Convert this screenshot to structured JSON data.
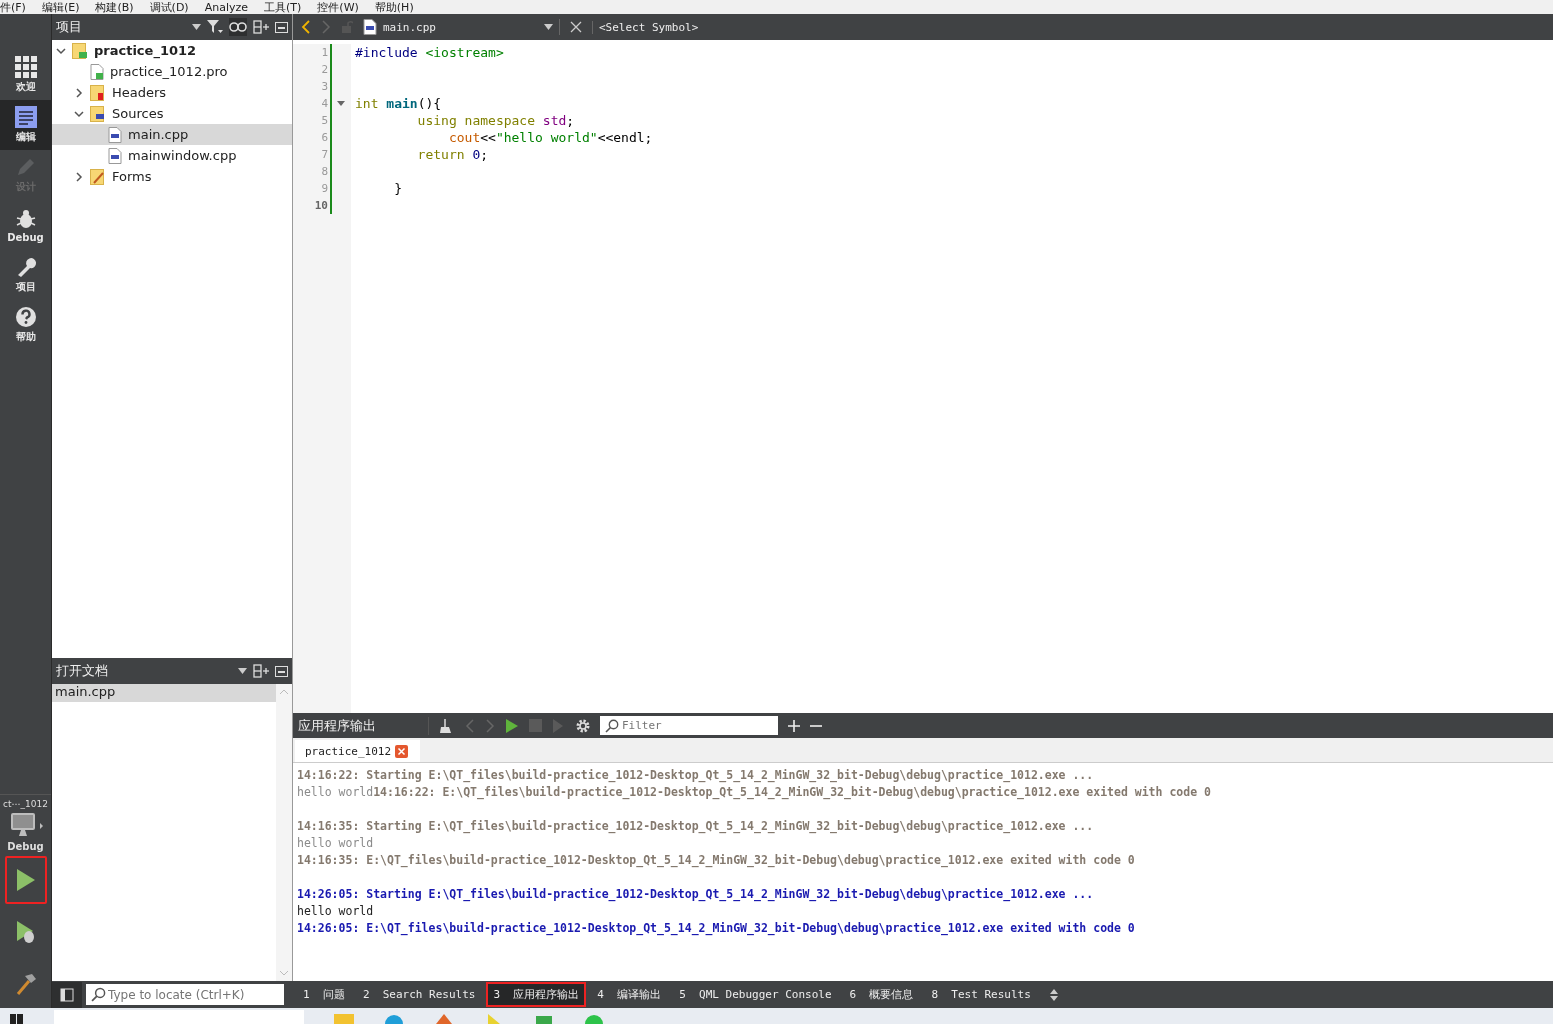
{
  "menu": [
    "件(F)",
    "编辑(E)",
    "构建(B)",
    "调试(D)",
    "Analyze",
    "工具(T)",
    "控件(W)",
    "帮助(H)"
  ],
  "modes": [
    {
      "label": "欢迎",
      "kind": "welcome",
      "selected": false,
      "disabled": false
    },
    {
      "label": "编辑",
      "kind": "edit",
      "selected": true,
      "disabled": false
    },
    {
      "label": "设计",
      "kind": "design",
      "selected": false,
      "disabled": true
    },
    {
      "label": "Debug",
      "kind": "debug",
      "selected": false,
      "disabled": false
    },
    {
      "label": "项目",
      "kind": "projects",
      "selected": false,
      "disabled": false
    },
    {
      "label": "帮助",
      "kind": "help",
      "selected": false,
      "disabled": false
    }
  ],
  "kit": {
    "project": "ct⋯_1012",
    "config": "Debug"
  },
  "run_buttons": [
    {
      "kind": "run",
      "highlighted": true
    },
    {
      "kind": "debug-run",
      "highlighted": false
    },
    {
      "kind": "build",
      "highlighted": false
    }
  ],
  "project_panel": {
    "title": "项目",
    "tree": [
      {
        "label": "practice_1012",
        "kind": "project",
        "expanded": true,
        "selected": false,
        "children": [
          {
            "label": "practice_1012.pro",
            "kind": "pro",
            "selected": false
          },
          {
            "label": "Headers",
            "kind": "headers",
            "expanded": false,
            "selected": false
          },
          {
            "label": "Sources",
            "kind": "sources",
            "expanded": true,
            "selected": false,
            "children": [
              {
                "label": "main.cpp",
                "kind": "cpp",
                "selected": true
              },
              {
                "label": "mainwindow.cpp",
                "kind": "cpp",
                "selected": false
              }
            ]
          },
          {
            "label": "Forms",
            "kind": "forms",
            "expanded": false,
            "selected": false
          }
        ]
      }
    ]
  },
  "open_documents": {
    "title": "打开文档",
    "items": [
      {
        "label": "main.cpp",
        "selected": true
      }
    ]
  },
  "editor": {
    "file": "main.cpp",
    "symbol": "<Select Symbol>",
    "lines": [
      {
        "number": "1",
        "current": false,
        "fold": false,
        "tokens": [
          {
            "text": "#include",
            "kind": "pre"
          },
          {
            "text": " <iostream>",
            "kind": "str"
          }
        ]
      },
      {
        "number": "2",
        "current": false,
        "fold": false
      },
      {
        "number": "3",
        "current": false,
        "fold": false
      },
      {
        "number": "4",
        "current": false,
        "fold": true,
        "tokens": [
          {
            "text": "int ",
            "kind": "kw"
          },
          {
            "text": "main",
            "kind": "fn"
          },
          {
            "text": "(){",
            "kind": "plain"
          }
        ]
      },
      {
        "number": "5",
        "current": false,
        "fold": false,
        "tokens": [
          {
            "text": "        using namespace ",
            "kind": "kw"
          },
          {
            "text": "std",
            "kind": "ns"
          },
          {
            "text": ";",
            "kind": "plain"
          }
        ]
      },
      {
        "number": "6",
        "current": false,
        "fold": false,
        "tokens": [
          {
            "text": "            cout",
            "kind": "var"
          },
          {
            "text": "<<",
            "kind": "plain"
          },
          {
            "text": "\"hello world\"",
            "kind": "str"
          },
          {
            "text": "<<endl;",
            "kind": "plain"
          }
        ]
      },
      {
        "number": "7",
        "current": false,
        "fold": false,
        "tokens": [
          {
            "text": "        return ",
            "kind": "kw"
          },
          {
            "text": "0",
            "kind": "num"
          },
          {
            "text": ";",
            "kind": "plain"
          }
        ]
      },
      {
        "number": "8",
        "current": false,
        "fold": false
      },
      {
        "number": "9",
        "current": false,
        "fold": false,
        "tokens": [
          {
            "text": "     }",
            "kind": "plain"
          }
        ]
      },
      {
        "number": "10",
        "current": true,
        "fold": false
      }
    ]
  },
  "output": {
    "title": "应用程序输出",
    "filter_placeholder": "Filter",
    "tab": "practice_1012",
    "blocks": [
      [
        [
          {
            "text": "14:16:22: Starting E:\\QT_files\\build-practice_1012-Desktop_Qt_5_14_2_MinGW_32_bit-Debug\\debug\\practice_1012.exe ...",
            "kind": "old-msg"
          }
        ],
        [
          {
            "text": "hello world",
            "kind": "old-out"
          },
          {
            "text": "14:16:22: E:\\QT_files\\build-practice_1012-Desktop_Qt_5_14_2_MinGW_32_bit-Debug\\debug\\practice_1012.exe exited with code 0",
            "kind": "old-msg"
          }
        ]
      ],
      [
        [
          {
            "text": "14:16:35: Starting E:\\QT_files\\build-practice_1012-Desktop_Qt_5_14_2_MinGW_32_bit-Debug\\debug\\practice_1012.exe ...",
            "kind": "old-msg"
          }
        ],
        [
          {
            "text": "hello world",
            "kind": "old-out"
          }
        ],
        [
          {
            "text": "14:16:35: E:\\QT_files\\build-practice_1012-Desktop_Qt_5_14_2_MinGW_32_bit-Debug\\debug\\practice_1012.exe exited with code 0",
            "kind": "old-msg"
          }
        ]
      ],
      [
        [
          {
            "text": "14:26:05: Starting E:\\QT_files\\build-practice_1012-Desktop_Qt_5_14_2_MinGW_32_bit-Debug\\debug\\practice_1012.exe ...",
            "kind": "msg"
          }
        ],
        [
          {
            "text": "hello world",
            "kind": "out"
          }
        ],
        [
          {
            "text": "14:26:05: E:\\QT_files\\build-practice_1012-Desktop_Qt_5_14_2_MinGW_32_bit-Debug\\debug\\practice_1012.exe exited with code 0",
            "kind": "msg"
          }
        ]
      ]
    ]
  },
  "status_bar": {
    "locate_placeholder": "Type to locate (Ctrl+K)",
    "tabs": [
      {
        "label": "1  问题",
        "selected": false,
        "highlighted": false
      },
      {
        "label": "2  Search Results",
        "selected": false,
        "highlighted": false
      },
      {
        "label": "3  应用程序输出",
        "selected": true,
        "highlighted": true
      },
      {
        "label": "4  编译输出",
        "selected": false,
        "highlighted": false
      },
      {
        "label": "5  QML Debugger Console",
        "selected": false,
        "highlighted": false
      },
      {
        "label": "6  概要信息",
        "selected": false,
        "highlighted": false
      },
      {
        "label": "8  Test Results",
        "selected": false,
        "highlighted": false
      }
    ]
  }
}
